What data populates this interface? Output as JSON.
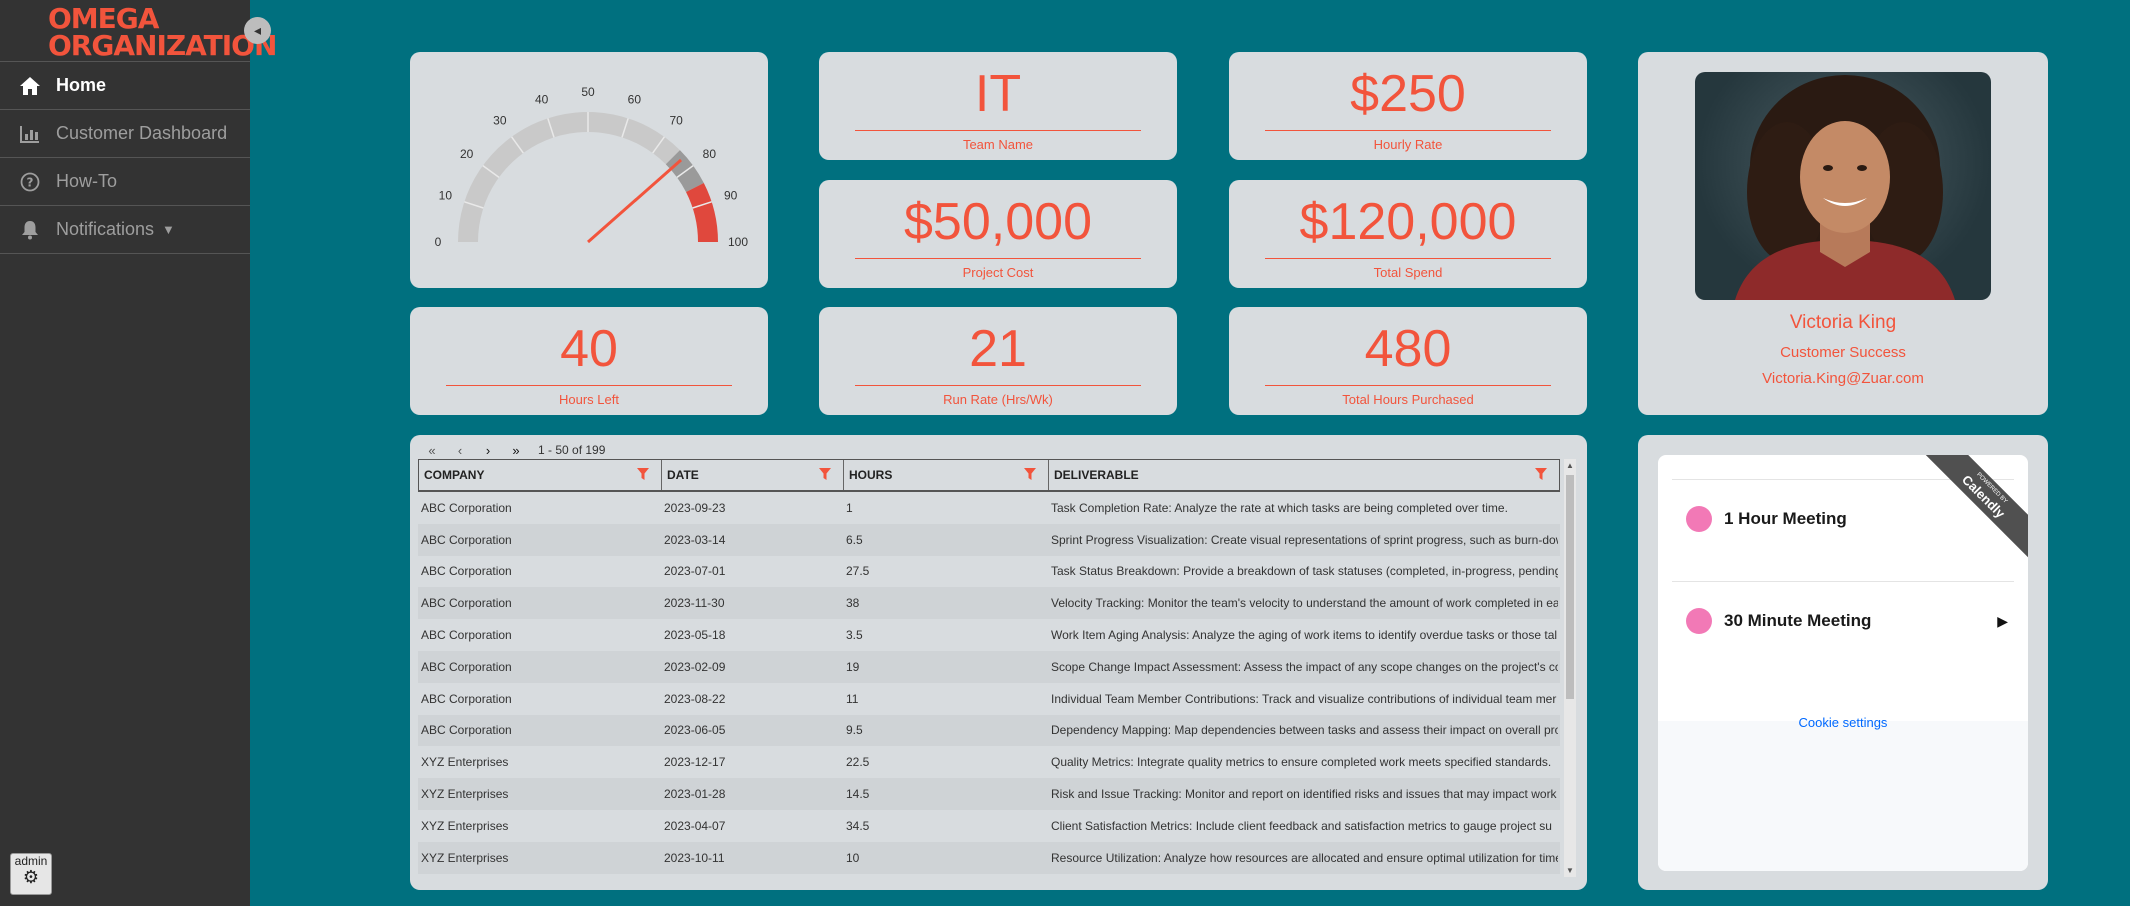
{
  "app": {
    "logo_line1": "OMEGA",
    "logo_line2": "ORGANIZATION",
    "collapse_glyph": "◂"
  },
  "nav": [
    {
      "label": "Home",
      "icon": "home-icon"
    },
    {
      "label": "Customer Dashboard",
      "icon": "bar-chart-icon"
    },
    {
      "label": "How-To",
      "icon": "question-icon"
    },
    {
      "label": "Notifications",
      "icon": "bell-icon"
    }
  ],
  "admin": {
    "label": "admin"
  },
  "gauge": {
    "min": 0,
    "max": 100,
    "value": 77,
    "ticks": [
      "0",
      "10",
      "20",
      "30",
      "40",
      "50",
      "60",
      "70",
      "80",
      "90",
      "100"
    ],
    "colors": {
      "track": "#c9c9c9",
      "mid": "#9a9a9a",
      "high": "#e0483d",
      "needle": "#f2543c"
    }
  },
  "kpis": {
    "team_name": {
      "value": "IT",
      "label": "Team Name"
    },
    "hourly_rate": {
      "value": "$250",
      "label": "Hourly Rate"
    },
    "project_cost": {
      "value": "$50,000",
      "label": "Project Cost"
    },
    "total_spend": {
      "value": "$120,000",
      "label": "Total Spend"
    },
    "hours_left": {
      "value": "40",
      "label": "Hours Left"
    },
    "run_rate": {
      "value": "21",
      "label": "Run Rate (Hrs/Wk)"
    },
    "total_hours": {
      "value": "480",
      "label": "Total Hours Purchased"
    }
  },
  "profile": {
    "name": "Victoria King",
    "title": "Customer Success",
    "email": "Victoria.King@Zuar.com"
  },
  "table": {
    "pager_text": "1 - 50 of 199",
    "columns": [
      "COMPANY",
      "DATE",
      "HOURS",
      "DELIVERABLE"
    ],
    "rows": [
      [
        "ABC Corporation",
        "2023-09-23",
        "1",
        "Task Completion Rate: Analyze the rate at which tasks are being completed over time."
      ],
      [
        "ABC Corporation",
        "2023-03-14",
        "6.5",
        "Sprint Progress Visualization: Create visual representations of sprint progress, such as burn-dow"
      ],
      [
        "ABC Corporation",
        "2023-07-01",
        "27.5",
        "Task Status Breakdown: Provide a breakdown of task statuses (completed, in-progress, pending"
      ],
      [
        "ABC Corporation",
        "2023-11-30",
        "38",
        "Velocity Tracking: Monitor the team's velocity to understand the amount of work completed in ea"
      ],
      [
        "ABC Corporation",
        "2023-05-18",
        "3.5",
        "Work Item Aging Analysis: Analyze the aging of work items to identify overdue tasks or those tal"
      ],
      [
        "ABC Corporation",
        "2023-02-09",
        "19",
        "Scope Change Impact Assessment: Assess the impact of any scope changes on the project's co"
      ],
      [
        "ABC Corporation",
        "2023-08-22",
        "11",
        "Individual Team Member Contributions: Track and visualize contributions of individual team mer"
      ],
      [
        "ABC Corporation",
        "2023-06-05",
        "9.5",
        "Dependency Mapping: Map dependencies between tasks and assess their impact on overall pro"
      ],
      [
        "XYZ Enterprises",
        "2023-12-17",
        "22.5",
        "Quality Metrics: Integrate quality metrics to ensure completed work meets specified standards."
      ],
      [
        "XYZ Enterprises",
        "2023-01-28",
        "14.5",
        "Risk and Issue Tracking: Monitor and report on identified risks and issues that may impact work"
      ],
      [
        "XYZ Enterprises",
        "2023-04-07",
        "34.5",
        "Client Satisfaction Metrics: Include client feedback and satisfaction metrics to gauge project su"
      ],
      [
        "XYZ Enterprises",
        "2023-10-11",
        "10",
        "Resource Utilization: Analyze how resources are allocated and ensure optimal utilization for time"
      ]
    ]
  },
  "calendly": {
    "ribbon_small": "POWERED BY",
    "ribbon_big": "Calendly",
    "events": [
      {
        "name": "1 Hour Meeting"
      },
      {
        "name": "30 Minute Meeting"
      }
    ],
    "cookie": "Cookie settings"
  },
  "colors": {
    "background": "#00707f",
    "sidebar": "#333333",
    "card": "#d8dcdf",
    "accent": "#f2543c",
    "calendly_dot": "#f279b6"
  }
}
